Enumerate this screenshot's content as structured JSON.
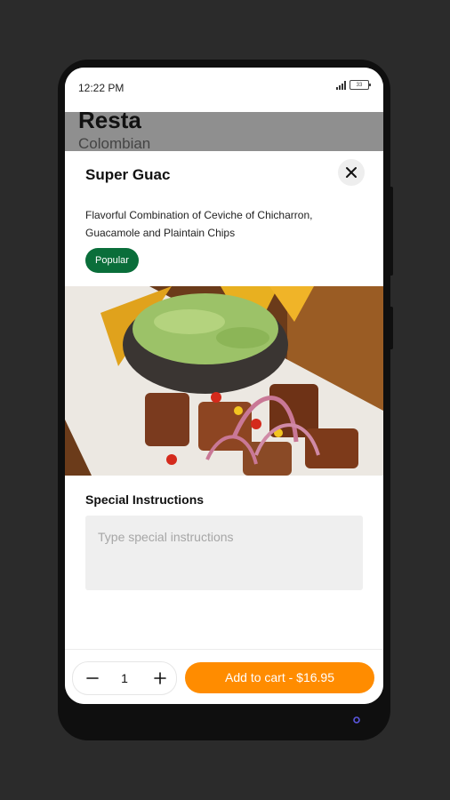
{
  "status_bar": {
    "time": "12:22 PM",
    "battery": "33"
  },
  "restaurant": {
    "name": "Resta",
    "cuisine": "Colombian"
  },
  "item": {
    "title": "Super Guac",
    "description": "Flavorful Combination of Ceviche of Chicharron, Guacamole and Plaintain Chips",
    "badge": "Popular"
  },
  "special_instructions": {
    "label": "Special Instructions",
    "placeholder": "Type special instructions",
    "value": ""
  },
  "cart": {
    "quantity": "1",
    "add_label": "Add to cart - $16.95"
  },
  "colors": {
    "accent": "#ff8c00",
    "badge": "#0a6e3a",
    "input_bg": "#efefef"
  },
  "icons": {
    "close": "close-icon",
    "minus": "minus-icon",
    "plus": "plus-icon",
    "signal": "signal-icon",
    "battery": "battery-icon"
  }
}
